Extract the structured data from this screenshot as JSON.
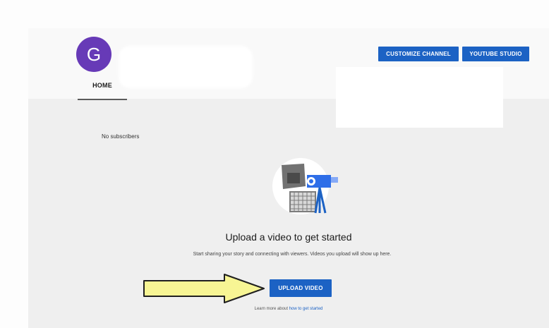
{
  "channel": {
    "avatar_letter": "G",
    "tabs": [
      "HOME"
    ],
    "subscribers": "No subscribers"
  },
  "header_actions": {
    "customize_label": "CUSTOMIZE CHANNEL",
    "studio_label": "YOUTUBE STUDIO"
  },
  "empty_state": {
    "title": "Upload a video to get started",
    "description": "Start sharing your story and connecting with viewers. Videos you upload will show up here.",
    "upload_button": "UPLOAD VIDEO",
    "learn_more_prefix": "Learn more about",
    "learn_more_link": "how to get started"
  },
  "colors": {
    "avatar": "#673ab7",
    "button_blue": "#1c62c4",
    "arrow_fill": "#f7f594"
  },
  "icons": {
    "avatar": "letter-avatar",
    "illustration": "camera-person-illustration",
    "annotation": "yellow-arrow"
  }
}
